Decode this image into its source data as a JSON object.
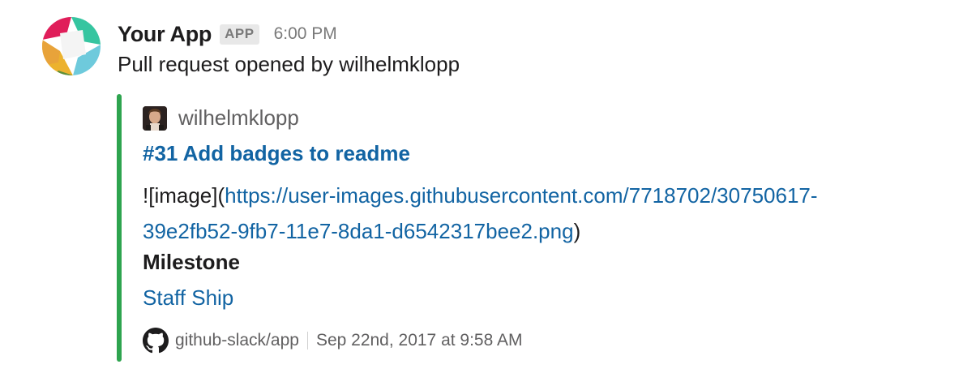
{
  "message": {
    "app_name": "Your App",
    "app_badge": "APP",
    "timestamp": "6:00 PM",
    "text": "Pull request opened by wilhelmklopp",
    "avatar_icon": "app-logo-icon"
  },
  "attachment": {
    "accent_color": "#2ea44f",
    "author_name": "wilhelmklopp",
    "author_avatar_icon": "user-avatar-icon",
    "title": "#31 Add badges to readme",
    "body_prefix": "![image](",
    "body_link_line1": "https://user-images.githubusercontent.com/7718702/30750617-",
    "body_link_line2": "39e2fb52-9fb7-11e7-8da1-d6542317bee2.png",
    "body_suffix": ")",
    "field_title": "Milestone",
    "field_value": "Staff Ship",
    "footer_icon": "github-icon",
    "footer_source": "github-slack/app",
    "footer_timestamp": "Sep 22nd, 2017 at 9:58 AM"
  },
  "colors": {
    "link": "#1264a3",
    "text": "#1d1c1d",
    "muted": "#616061"
  }
}
